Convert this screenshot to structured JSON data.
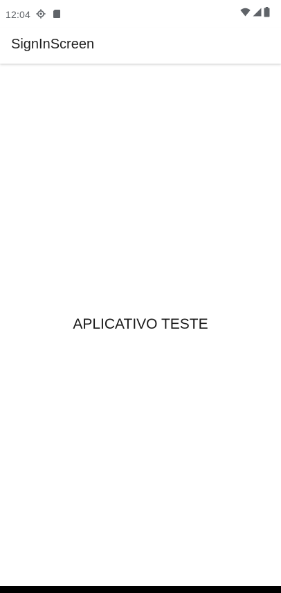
{
  "status_bar": {
    "time": "12:04",
    "left_icons": [
      "settings-icon",
      "sd-card-icon"
    ],
    "right_icons": [
      "wifi-icon",
      "signal-icon",
      "battery-icon"
    ]
  },
  "app_bar": {
    "title": "SignInScreen"
  },
  "main": {
    "text": "APLICATIVO TESTE"
  },
  "colors": {
    "status_icons": "#5f6368",
    "title_text": "#1f1f1f",
    "body_text": "#1a1a1a",
    "background": "#ffffff",
    "nav_bar": "#000000"
  }
}
